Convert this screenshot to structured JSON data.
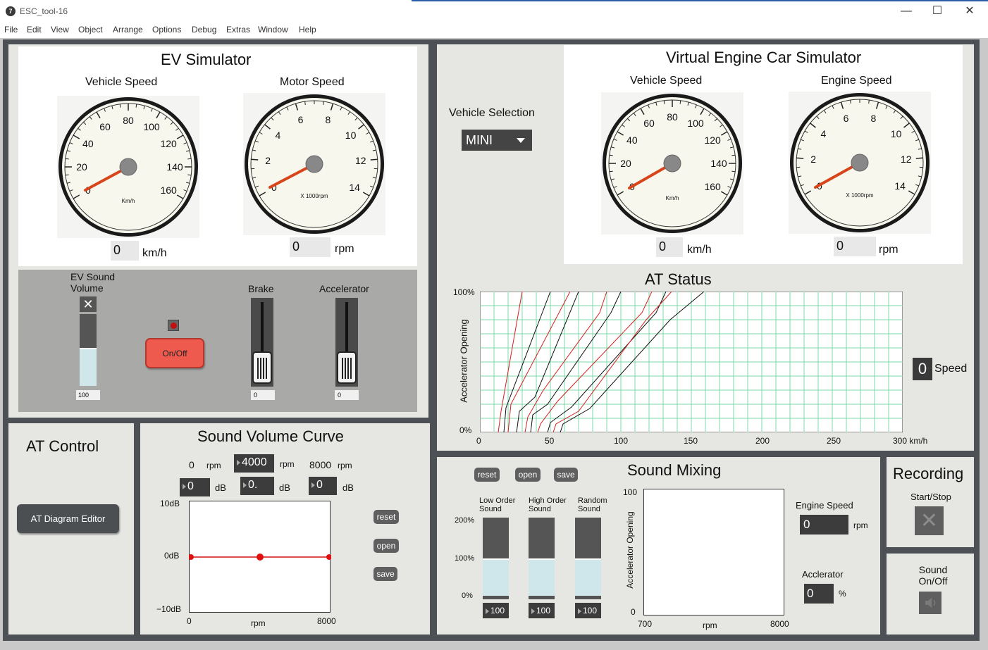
{
  "window": {
    "title": "ESC_tool-16",
    "app_icon": "7",
    "min_glyph": "—",
    "max_glyph": "☐",
    "close_glyph": "✕"
  },
  "menu": [
    "File",
    "Edit",
    "View",
    "Object",
    "Arrange",
    "Options",
    "Debug",
    "Extras",
    "Window",
    "Help"
  ],
  "ev": {
    "title": "EV Simulator",
    "vehicle_speed_label": "Vehicle Speed",
    "motor_speed_label": "Motor Speed",
    "speed_value": "0",
    "speed_unit": "km/h",
    "motor_value": "0",
    "motor_unit": "rpm",
    "gauge_speed_unit": "Km/h",
    "gauge_motor_unit": "X 1000rpm",
    "sound_volume_label": "EV Sound Volume",
    "sound_volume_value": "100",
    "onoff_label": "On/Off",
    "brake_label": "Brake",
    "brake_value": "0",
    "accel_label": "Accelerator",
    "accel_value": "0"
  },
  "speed_gauge_ticks": [
    "0",
    "20",
    "40",
    "60",
    "80",
    "100",
    "120",
    "140",
    "160"
  ],
  "rpm_gauge_ticks": [
    "0",
    "2",
    "4",
    "6",
    "8",
    "10",
    "12",
    "14"
  ],
  "vec": {
    "title": "Virtual Engine Car Simulator",
    "vehicle_selection_label": "Vehicle Selection",
    "vehicle_selected": "MINI",
    "vehicle_speed_label": "Vehicle Speed",
    "engine_speed_label": "Engine Speed",
    "speed_value": "0",
    "speed_unit": "km/h",
    "engine_value": "0",
    "engine_unit": "rpm",
    "gauge_speed_unit": "Km/h",
    "gauge_rpm_unit": "X 1000rpm"
  },
  "at_status": {
    "title": "AT Status",
    "y_axis_label": "Accelerator Opening",
    "y_ticks": [
      "100%",
      "0%"
    ],
    "x_ticks": [
      "0",
      "50",
      "100",
      "150",
      "200",
      "250",
      "300 km/h"
    ],
    "speed_value": "0",
    "speed_label": "Speed"
  },
  "at_control": {
    "title": "AT Control",
    "editor_button": "AT Diagram Editor"
  },
  "sound_curve": {
    "title": "Sound Volume Curve",
    "rpm_low": "0",
    "rpm_mid": "4000",
    "rpm_high": "8000",
    "rpm_unit": "rpm",
    "db_low": "0",
    "db_mid": "0.",
    "db_high": "0",
    "db_unit": "dB",
    "y_top": "10dB",
    "y_mid": "0dB",
    "y_bottom": "−10dB",
    "x_left": "0",
    "x_mid": "rpm",
    "x_right": "8000",
    "reset": "reset",
    "open": "open",
    "save": "save"
  },
  "sound_mixing": {
    "title": "Sound Mixing",
    "reset": "reset",
    "open": "open",
    "save": "save",
    "low_label": "Low Order Sound",
    "high_label": "High Order Sound",
    "random_label": "Random Sound",
    "y_200": "200%",
    "y_100": "100%",
    "y_0": "0%",
    "low_value": "100",
    "high_value": "100",
    "random_value": "100",
    "chart_y_axis": "Accelerator Opening",
    "chart_y_top": "100",
    "chart_y_bottom": "0",
    "chart_x_left": "700",
    "chart_x_mid": "rpm",
    "chart_x_right": "8000",
    "engine_speed_label": "Engine Speed",
    "engine_speed_value": "0",
    "engine_speed_unit": "rpm",
    "accel_label": "Acclerator",
    "accel_value": "0",
    "accel_unit": "%"
  },
  "recording": {
    "title": "Recording",
    "start_stop": "Start/Stop",
    "sound_onoff": "Sound On/Off"
  }
}
